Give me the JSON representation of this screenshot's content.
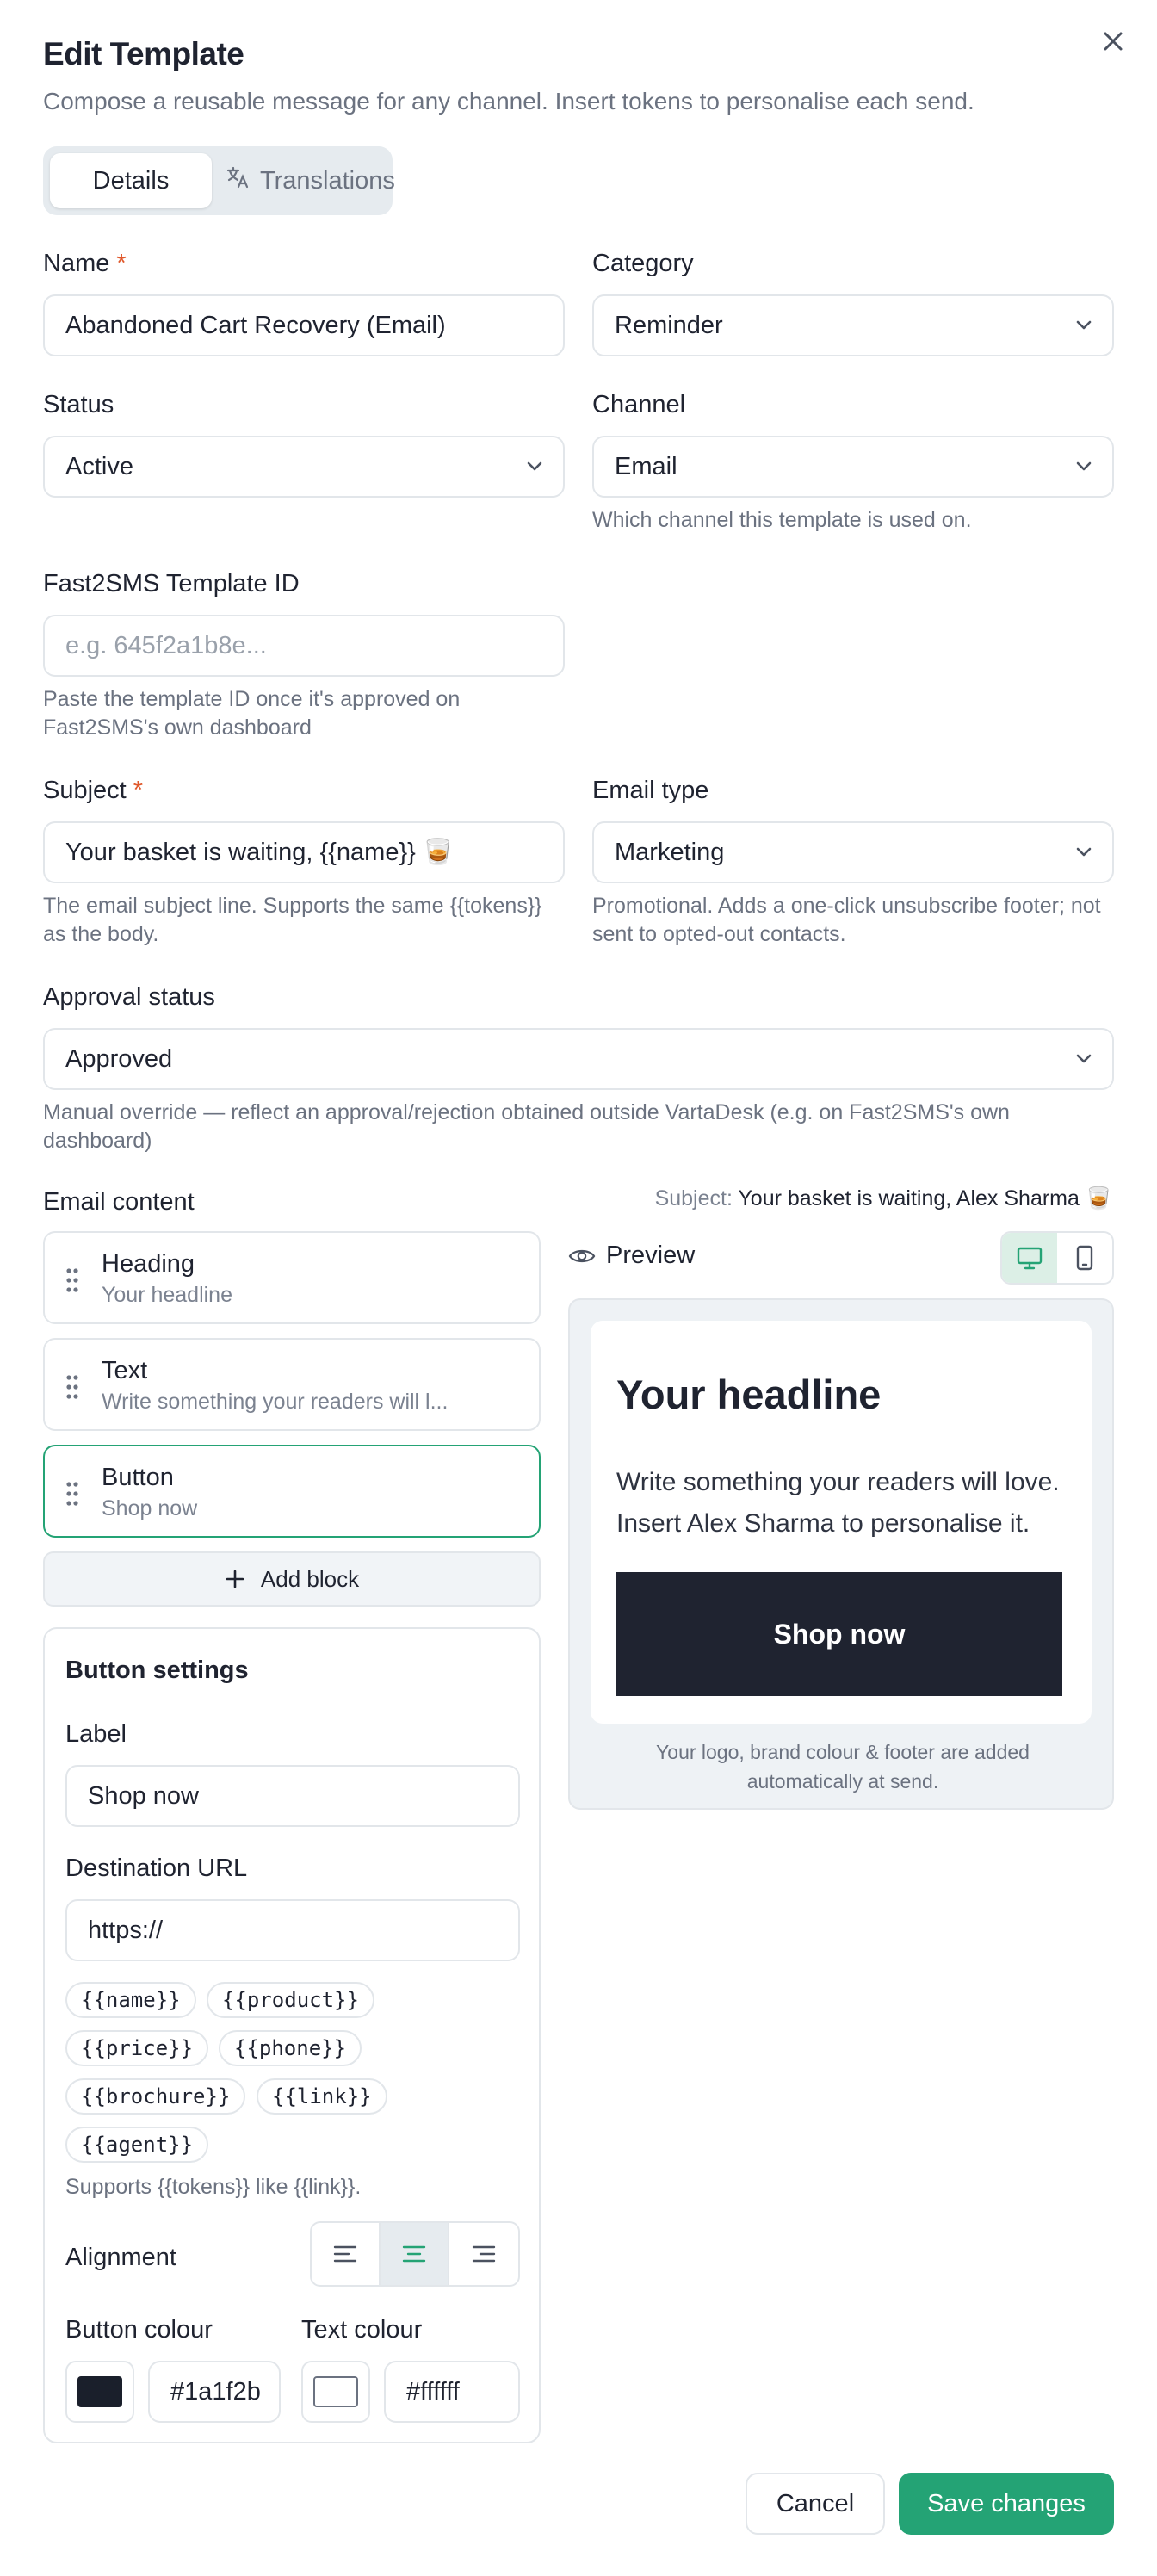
{
  "modal": {
    "title": "Edit Template",
    "subtitle": "Compose a reusable message for any channel. Insert tokens to personalise each send."
  },
  "tabs": [
    {
      "label": "Details",
      "active": true
    },
    {
      "label": "Translations",
      "icon": "translate-icon"
    }
  ],
  "form": {
    "name": {
      "label": "Name",
      "required_mark": "*",
      "value": "Abandoned Cart Recovery (Email)"
    },
    "category": {
      "label": "Category",
      "value": "Reminder"
    },
    "status": {
      "label": "Status",
      "value": "Active"
    },
    "channel": {
      "label": "Channel",
      "value": "Email",
      "help": "Which channel this template is used on."
    },
    "fast2sms_id": {
      "label": "Fast2SMS Template ID",
      "placeholder": "e.g. 645f2a1b8e...",
      "help": "Paste the template ID once it's approved on Fast2SMS's own dashboard"
    },
    "subject": {
      "label": "Subject",
      "required_mark": "*",
      "value": "Your basket is waiting, {{name}} 🥃",
      "help": "The email subject line. Supports the same {{tokens}} as the body."
    },
    "email_type": {
      "label": "Email type",
      "value": "Marketing",
      "help": "Promotional. Adds a one-click unsubscribe footer; not sent to opted-out contacts."
    },
    "approval_status": {
      "label": "Approval status",
      "value": "Approved",
      "help": "Manual override — reflect an approval/rejection obtained outside VartaDesk (e.g. on Fast2SMS's own dashboard)"
    }
  },
  "email_content": {
    "label": "Email content",
    "subject_preview_label": "Subject:",
    "subject_preview_value": "Your basket is waiting, Alex Sharma 🥃",
    "blocks": [
      {
        "title": "Heading",
        "subtitle": "Your headline"
      },
      {
        "title": "Text",
        "subtitle": "Write something your readers will l..."
      },
      {
        "title": "Button",
        "subtitle": "Shop now",
        "selected": true
      }
    ],
    "add_block_label": "Add block"
  },
  "button_settings": {
    "title": "Button settings",
    "label_field": {
      "label": "Label",
      "value": "Shop now"
    },
    "url_field": {
      "label": "Destination URL",
      "value": "https://"
    },
    "tokens": [
      "{{name}}",
      "{{product}}",
      "{{price}}",
      "{{phone}}",
      "{{brochure}}",
      "{{link}}",
      "{{agent}}"
    ],
    "tokens_help": "Supports {{tokens}} like {{link}}.",
    "alignment_label": "Alignment",
    "alignment_selected": "center",
    "button_colour_label": "Button colour",
    "button_colour_value": "#1a1f2b",
    "text_colour_label": "Text colour",
    "text_colour_value": "#ffffff"
  },
  "preview": {
    "label": "Preview",
    "device_selected": "desktop",
    "headline": "Your headline",
    "body": "Write something your readers will love. Insert Alex Sharma to personalise it.",
    "button_label": "Shop now",
    "footer_note": "Your logo, brand colour & footer are added automatically at send."
  },
  "actions": {
    "cancel_label": "Cancel",
    "save_label": "Save changes"
  },
  "colors": {
    "accent": "#24a375",
    "required": "#e0582b",
    "button_bg": "#1a1f2b"
  }
}
